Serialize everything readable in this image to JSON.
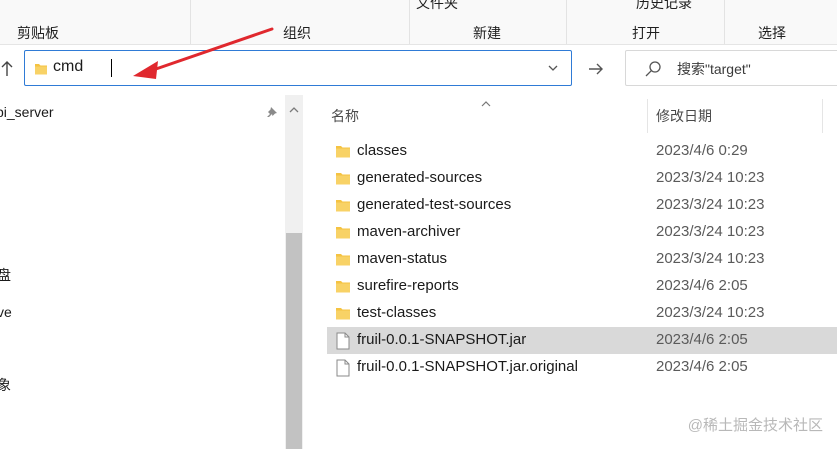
{
  "ribbon": {
    "clipped_top": [
      "文件夹",
      "历史记录"
    ],
    "groups": [
      "剪贴板",
      "组织",
      "新建",
      "打开",
      "选择"
    ]
  },
  "address_bar": {
    "value": "cmd"
  },
  "search": {
    "placeholder": "搜索\"target\""
  },
  "nav_pane": {
    "items": [
      "pi_server",
      "盘",
      "ve",
      "象"
    ]
  },
  "file_list": {
    "columns": {
      "name": "名称",
      "date": "修改日期"
    },
    "rows": [
      {
        "name": "classes",
        "date": "2023/4/6 0:29",
        "type": "folder"
      },
      {
        "name": "generated-sources",
        "date": "2023/3/24 10:23",
        "type": "folder"
      },
      {
        "name": "generated-test-sources",
        "date": "2023/3/24 10:23",
        "type": "folder"
      },
      {
        "name": "maven-archiver",
        "date": "2023/3/24 10:23",
        "type": "folder"
      },
      {
        "name": "maven-status",
        "date": "2023/3/24 10:23",
        "type": "folder"
      },
      {
        "name": "surefire-reports",
        "date": "2023/4/6 2:05",
        "type": "folder"
      },
      {
        "name": "test-classes",
        "date": "2023/3/24 10:23",
        "type": "folder"
      },
      {
        "name": "fruil-0.0.1-SNAPSHOT.jar",
        "date": "2023/4/6 2:05",
        "type": "file",
        "selected": true
      },
      {
        "name": "fruil-0.0.1-SNAPSHOT.jar.original",
        "date": "2023/4/6 2:05",
        "type": "file"
      }
    ]
  },
  "watermark": "@稀土掘金技术社区",
  "colors": {
    "accent": "#2f7bd6",
    "folder": "#f5c342",
    "annotation": "#e0282e",
    "selected_row": "#d9d9d9"
  }
}
